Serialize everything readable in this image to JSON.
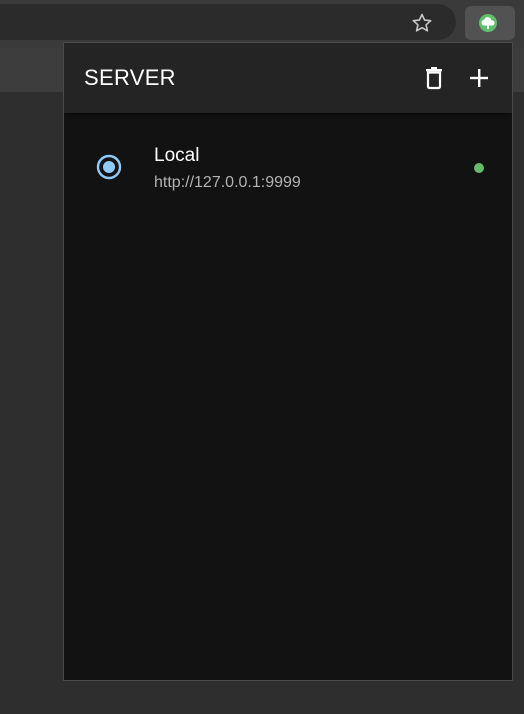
{
  "browser": {
    "star_icon": "star-outline-icon",
    "extension_icon": "cloud-upload-icon",
    "extension_color": "#5fbf6a"
  },
  "popup": {
    "title": "SERVER",
    "actions": [
      {
        "name": "delete",
        "icon": "trash-icon"
      },
      {
        "name": "add",
        "icon": "plus-icon"
      }
    ],
    "servers": [
      {
        "name": "Local",
        "url": "http://127.0.0.1:9999",
        "selected": true,
        "status_color": "#66bb6a"
      }
    ],
    "accent_color": "#90caf9"
  }
}
